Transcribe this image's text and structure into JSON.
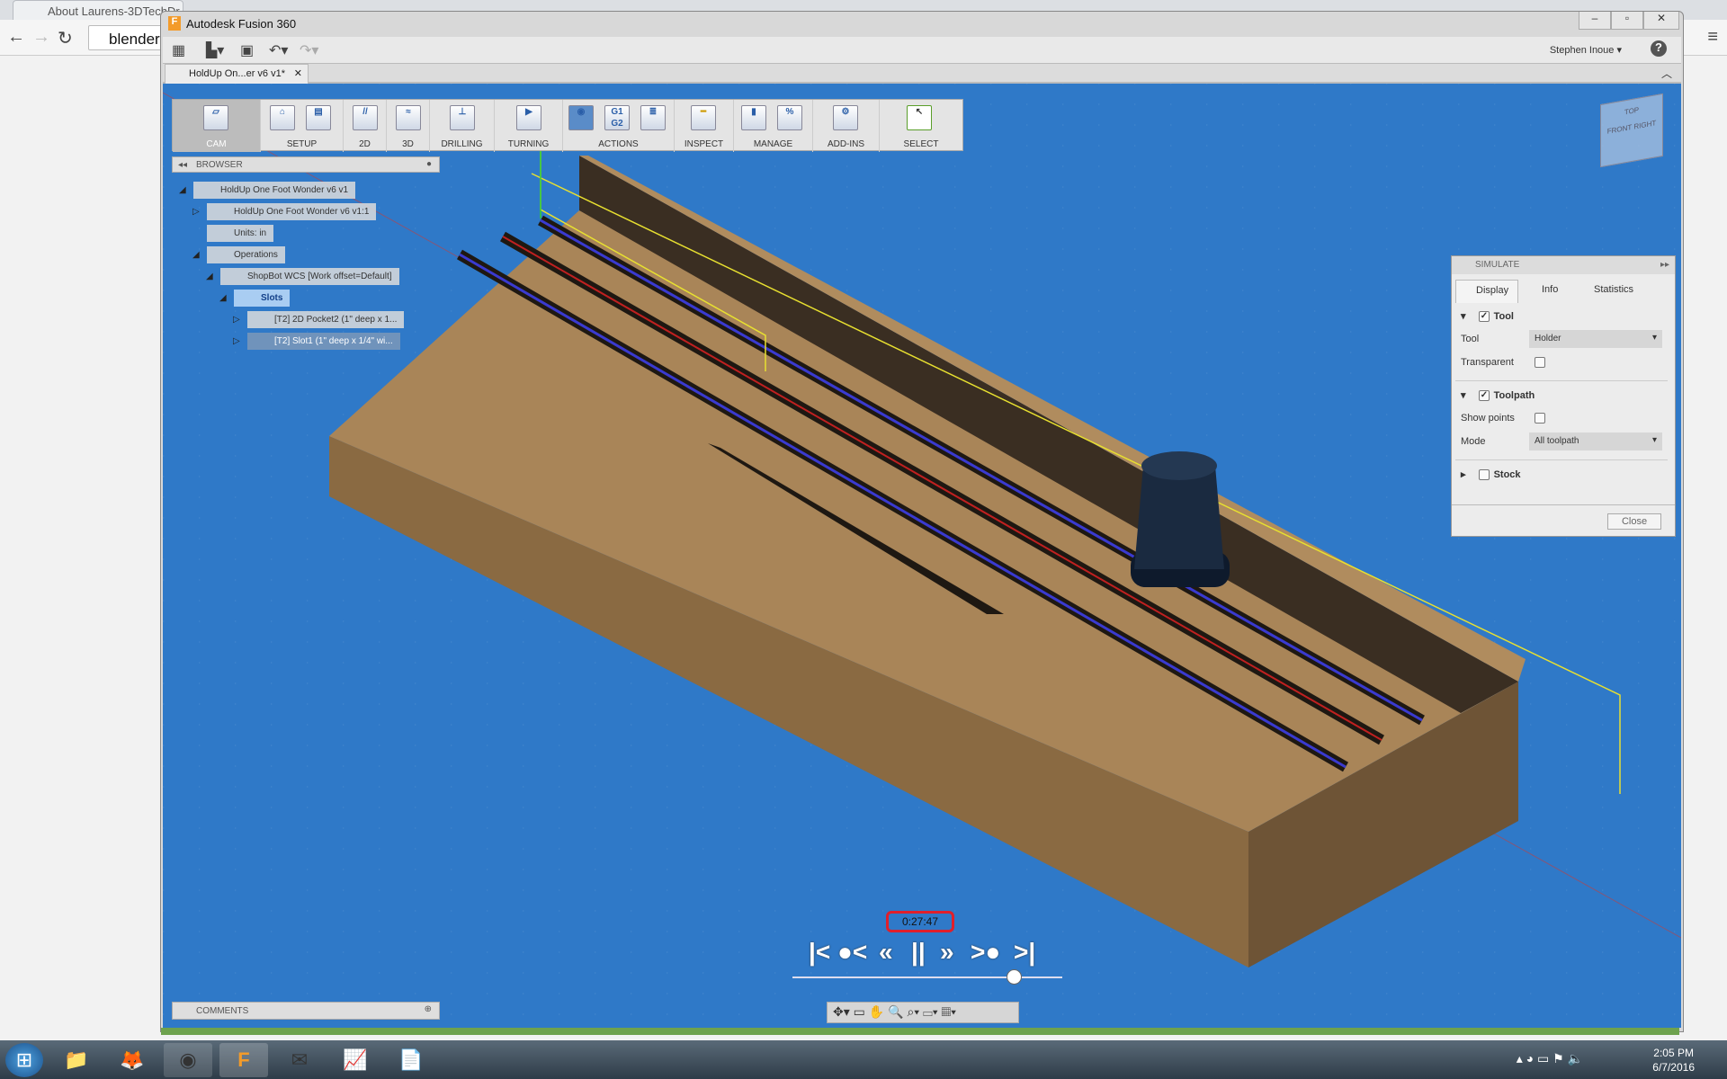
{
  "browser_chrome": {
    "tabs": [
      "About Laurens-3DTechDr..."
    ],
    "address": "blender."
  },
  "app": {
    "title": "Autodesk Fusion 360",
    "user": "Stephen Inoue",
    "doc_tab": "HoldUp On...er v6 v1*"
  },
  "ribbon": {
    "groups": [
      "CAM",
      "SETUP",
      "2D",
      "3D",
      "DRILLING",
      "TURNING",
      "ACTIONS",
      "INSPECT",
      "MANAGE",
      "ADD-INS",
      "SELECT"
    ]
  },
  "browser": {
    "title": "BROWSER",
    "items": [
      {
        "label": "HoldUp One Foot Wonder v6 v1",
        "indent": 0
      },
      {
        "label": "HoldUp One Foot Wonder v6 v1:1",
        "indent": 1
      },
      {
        "label": "Units: in",
        "indent": 1
      },
      {
        "label": "Operations",
        "indent": 1
      },
      {
        "label": "ShopBot WCS [Work offset=Default]",
        "indent": 2
      },
      {
        "label": "Slots",
        "indent": 3
      },
      {
        "label": "[T2] 2D Pocket2 (1\" deep x 1...",
        "indent": 4
      },
      {
        "label": "[T2] Slot1 (1\" deep x 1/4\" wi...",
        "indent": 4
      }
    ]
  },
  "view_cube": {
    "top": "TOP",
    "front": "FRONT",
    "right": "RIGHT"
  },
  "simulate": {
    "title": "SIMULATE",
    "tabs": [
      "Display",
      "Info",
      "Statistics"
    ],
    "tool_section": "Tool",
    "tool_checked": true,
    "tool_label": "Tool",
    "tool_value": "Holder",
    "transparent_label": "Transparent",
    "transparent": false,
    "toolpath_section": "Toolpath",
    "toolpath_checked": true,
    "show_points_label": "Show points",
    "show_points": false,
    "mode_label": "Mode",
    "mode_value": "All toolpath",
    "stock_section": "Stock",
    "stock_checked": false,
    "close": "Close"
  },
  "playback": {
    "time": "0:27:47",
    "position_fraction": 0.82
  },
  "comments": {
    "title": "COMMENTS"
  },
  "taskbar": {
    "time": "2:05 PM",
    "date": "6/7/2016"
  },
  "colors": {
    "viewport": "#2f79c8",
    "timer_border": "#e01f2b",
    "progress": "#6ea24e"
  }
}
